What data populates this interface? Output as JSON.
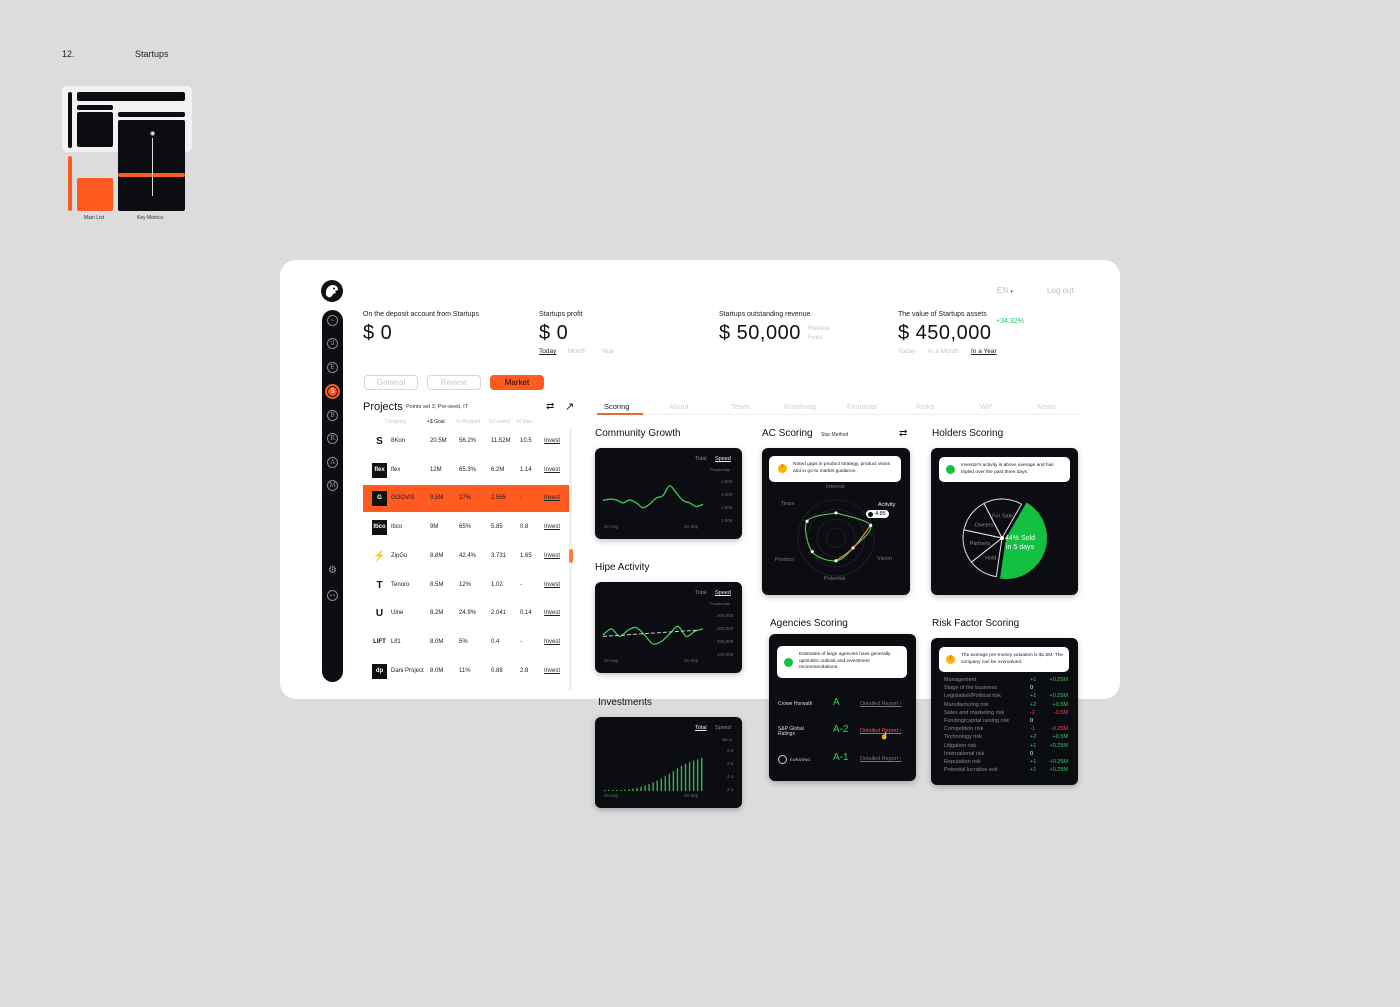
{
  "slide": {
    "number": "12.",
    "title": "Startups"
  },
  "thumbnail": {
    "captions": [
      "Main List",
      "Key Metrics"
    ]
  },
  "topbar": {
    "language": "EN",
    "language_caret": "▾",
    "logout": "Log out"
  },
  "sidebar": {
    "items": [
      {
        "icon": "trend-icon",
        "glyph": "~"
      },
      {
        "icon": "bar-chart-icon",
        "glyph": "ıl"
      },
      {
        "icon": "letter-e-icon",
        "glyph": "E"
      },
      {
        "icon": "letter-s-icon",
        "glyph": "S",
        "active": true
      },
      {
        "icon": "letter-b-icon",
        "glyph": "B"
      },
      {
        "icon": "letter-r-icon",
        "glyph": "R"
      },
      {
        "icon": "letter-a-icon",
        "glyph": "A"
      },
      {
        "icon": "letter-m-icon",
        "glyph": "M"
      }
    ],
    "bottom": [
      {
        "icon": "gear-icon",
        "glyph": "⚙"
      },
      {
        "icon": "logout-icon",
        "glyph": "↦"
      }
    ]
  },
  "metrics": [
    {
      "label": "On the deposit account from Startups",
      "value": "$ 0"
    },
    {
      "label": "Startups profit",
      "value": "$ 0",
      "periods": [
        "Today",
        "Month",
        "Year"
      ],
      "active_period": "Today"
    },
    {
      "label": "Startups outstanding revenue",
      "value": "$ 50,000",
      "side": [
        "Review",
        "Fees"
      ]
    },
    {
      "label": "The value of Startups assets",
      "value": "$ 450,000",
      "change": "+34.32%",
      "periods": [
        "Today",
        "In a Month",
        "In a Year"
      ],
      "active_period": "In a Year"
    }
  ],
  "segments": {
    "items": [
      "General",
      "Review",
      "Market"
    ],
    "active": "Market"
  },
  "projects": {
    "title": "Projects",
    "subtitle": "Points set 3, Pre-seed, IT",
    "columns": [
      "Company",
      "+$ Goal",
      "% Pledged",
      "$ Funded",
      "M Mau"
    ],
    "rows": [
      {
        "logo": "S",
        "logo_style": "plain",
        "name": "8Kon",
        "goal": "20.5M",
        "pledged": "56.2%",
        "funded": "11.52M",
        "mau": "10.5",
        "action": "Invest"
      },
      {
        "logo": "flex",
        "logo_style": "box",
        "name": "flex",
        "goal": "12M",
        "pledged": "65.3%",
        "funded": "6.2M",
        "mau": "1.14",
        "action": "Invest"
      },
      {
        "logo": "G",
        "logo_style": "box",
        "name": "GOOVIS",
        "goal": "9.5M",
        "pledged": "27%",
        "funded": "2.565",
        "mau": "-",
        "action": "Invest",
        "selected": true
      },
      {
        "logo": "Itico",
        "logo_style": "box",
        "name": "Itico",
        "goal": "9M",
        "pledged": "65%",
        "funded": "5.85",
        "mau": "0.8",
        "action": "Invest"
      },
      {
        "logo": "⚡",
        "logo_style": "plain",
        "name": "ZipGo",
        "goal": "8.8M",
        "pledged": "42.4%",
        "funded": "3.731",
        "mau": "1.65",
        "action": "Invest"
      },
      {
        "logo": "T",
        "logo_style": "plain",
        "name": "Tenoro",
        "goal": "8.5M",
        "pledged": "12%",
        "funded": "1.02",
        "mau": "-",
        "action": "Invest"
      },
      {
        "logo": "U",
        "logo_style": "plain",
        "name": "Uine",
        "goal": "8.2M",
        "pledged": "24.9%",
        "funded": "2.041",
        "mau": "0.14",
        "action": "Invest"
      },
      {
        "logo": "LIFT",
        "logo_style": "plain",
        "name": "Lif1",
        "goal": "8.0M",
        "pledged": "5%",
        "funded": "0.4",
        "mau": "-",
        "action": "Invest"
      },
      {
        "logo": "dp",
        "logo_style": "box",
        "name": "Dani Project",
        "goal": "8.0M",
        "pledged": "11%",
        "funded": "0.88",
        "mau": "2.8",
        "action": "Invest"
      }
    ]
  },
  "tabs": {
    "items": [
      "Scoring",
      "About",
      "Team",
      "Roadmap",
      "Financial",
      "Risks",
      "WP",
      "News"
    ],
    "active": "Scoring"
  },
  "sections": {
    "community_growth": "Community Growth",
    "hipe_activity": "Hipe Activity",
    "investments": "Investments",
    "ac_scoring": "AC Scoring",
    "ac_method": "Star Method",
    "holders_scoring": "Holders Scoring",
    "agencies_scoring": "Agencies Scoring",
    "risk_factor_scoring": "Risk Factor Scoring"
  },
  "chart_data": [
    {
      "type": "line",
      "title": "Community Growth",
      "toggle": [
        "Total",
        "Speed"
      ],
      "toggle_active": "Speed",
      "unit": "People/day",
      "x_ticks": [
        "25 Aug",
        "25 Sep"
      ],
      "y_ticks": [
        "2,500",
        "2,000",
        "1,500",
        "1,000"
      ],
      "ylim": [
        1000,
        2800
      ],
      "series": [
        {
          "name": "Speed",
          "color": "#3ccb5a",
          "values": [
            1800,
            1850,
            1820,
            1700,
            1820,
            1700,
            1500,
            1650,
            1900,
            2000,
            2400,
            2100,
            1800,
            1700,
            1550,
            1650
          ]
        }
      ]
    },
    {
      "type": "line",
      "title": "Hipe Activity",
      "toggle": [
        "Total",
        "Speed"
      ],
      "toggle_active": "Speed",
      "unit": "People/day",
      "x_ticks": [
        "25 Aug",
        "25 Sep"
      ],
      "y_ticks": [
        "400,000",
        "300,000",
        "200,000",
        "100,000"
      ],
      "ylim": [
        100000,
        450000
      ],
      "series": [
        {
          "name": "Speed",
          "color": "#3ccb5a",
          "values": [
            250000,
            300000,
            240000,
            290000,
            310000,
            250000,
            180000,
            200000,
            260000,
            320000,
            240000,
            280000,
            300000
          ]
        },
        {
          "name": "Trend",
          "color": "#cccccc",
          "dashed": true,
          "values": [
            240000,
            250000,
            260000,
            270000,
            280000,
            290000
          ]
        }
      ]
    },
    {
      "type": "bar",
      "title": "Investments",
      "toggle": [
        "Total",
        "Speed"
      ],
      "toggle_active": "Total",
      "unit": "Mio $",
      "x_ticks": [
        "25 Aug",
        "25 Sep"
      ],
      "y_ticks": [
        "2.6",
        "2.5",
        "2.4",
        "2.3"
      ],
      "ylim": [
        2.3,
        2.7
      ],
      "values": [
        2.302,
        2.303,
        2.304,
        2.306,
        2.308,
        2.312,
        2.316,
        2.322,
        2.33,
        2.34,
        2.352,
        2.366,
        2.382,
        2.4,
        2.42,
        2.44,
        2.465,
        2.49,
        2.515,
        2.54,
        2.56,
        2.575,
        2.59,
        2.6,
        2.615
      ]
    },
    {
      "type": "radar",
      "title": "AC Scoring",
      "axes": [
        "Interest",
        "Activity",
        "Vision",
        "Potential",
        "Product",
        "Team"
      ],
      "values": [
        3.3,
        4.85,
        2.6,
        3.0,
        3.6,
        4.4
      ],
      "max": 5,
      "highlight": {
        "axis": "Activity",
        "value": "4.85"
      }
    },
    {
      "type": "pie",
      "title": "Holders Scoring",
      "slices": [
        {
          "label": "Sold",
          "value": 44,
          "color": "#14c042"
        },
        {
          "label": "Hold",
          "value": 12
        },
        {
          "label": "Partners",
          "value": 14
        },
        {
          "label": "Owners",
          "value": 14
        },
        {
          "label": "For Sale",
          "value": 16
        }
      ],
      "annotation": "44% Sold in 5 days"
    }
  ],
  "ac_alert": "Noted gaps in product strategy, product vision and in go-to market guidance.",
  "holders_alert": "Investor's activity is above average and has tripled over the past three days.",
  "holders_annotation": {
    "line1": "44% Sold",
    "line2": "in 5 days"
  },
  "radar_badge": "4.85",
  "agencies": {
    "alert": "Estimates of large agencies have generally optimistic outlook and investment recommendations.",
    "rows": [
      {
        "name": "Crowe Horwath",
        "grade": "A",
        "link": "Detailed Report ›"
      },
      {
        "name": "S&P Global Ratings",
        "grade": "A-2",
        "link": "Detailed Report ›",
        "hover": true
      },
      {
        "name": "EURATING",
        "grade": "A-1",
        "link": "Detailed Report ›"
      }
    ]
  },
  "risk": {
    "alert": "The average pre-money valuation is $1.5M. The company can be overvalued.",
    "rows": [
      {
        "name": "Management",
        "score": "+1",
        "money": "+0.25M"
      },
      {
        "name": "Stage of the business",
        "score": "0",
        "money": ""
      },
      {
        "name": "Legislation/Political risk",
        "score": "+1",
        "money": "+0.25M"
      },
      {
        "name": "Manufacturing risk",
        "score": "+2",
        "money": "+0.5M"
      },
      {
        "name": "Sales and marketing risk",
        "score": "-2",
        "money": "-0.5M"
      },
      {
        "name": "Funding/capital raising risk",
        "score": "0",
        "money": ""
      },
      {
        "name": "Competition risk",
        "score": "-1",
        "money": "-0.25M"
      },
      {
        "name": "Technology risk",
        "score": "+2",
        "money": "+0.5M"
      },
      {
        "name": "Litigation risk",
        "score": "+1",
        "money": "+0.25M"
      },
      {
        "name": "International risk",
        "score": "0",
        "money": ""
      },
      {
        "name": "Reputation risk",
        "score": "+1",
        "money": "+0.25M"
      },
      {
        "name": "Potential lucrative exit",
        "score": "+1",
        "money": "+0.25M"
      }
    ]
  },
  "colors": {
    "accent": "#ff5a1f",
    "positive": "#2fd05d",
    "negative": "#ff4a4a",
    "panel": "#0c0d12"
  }
}
